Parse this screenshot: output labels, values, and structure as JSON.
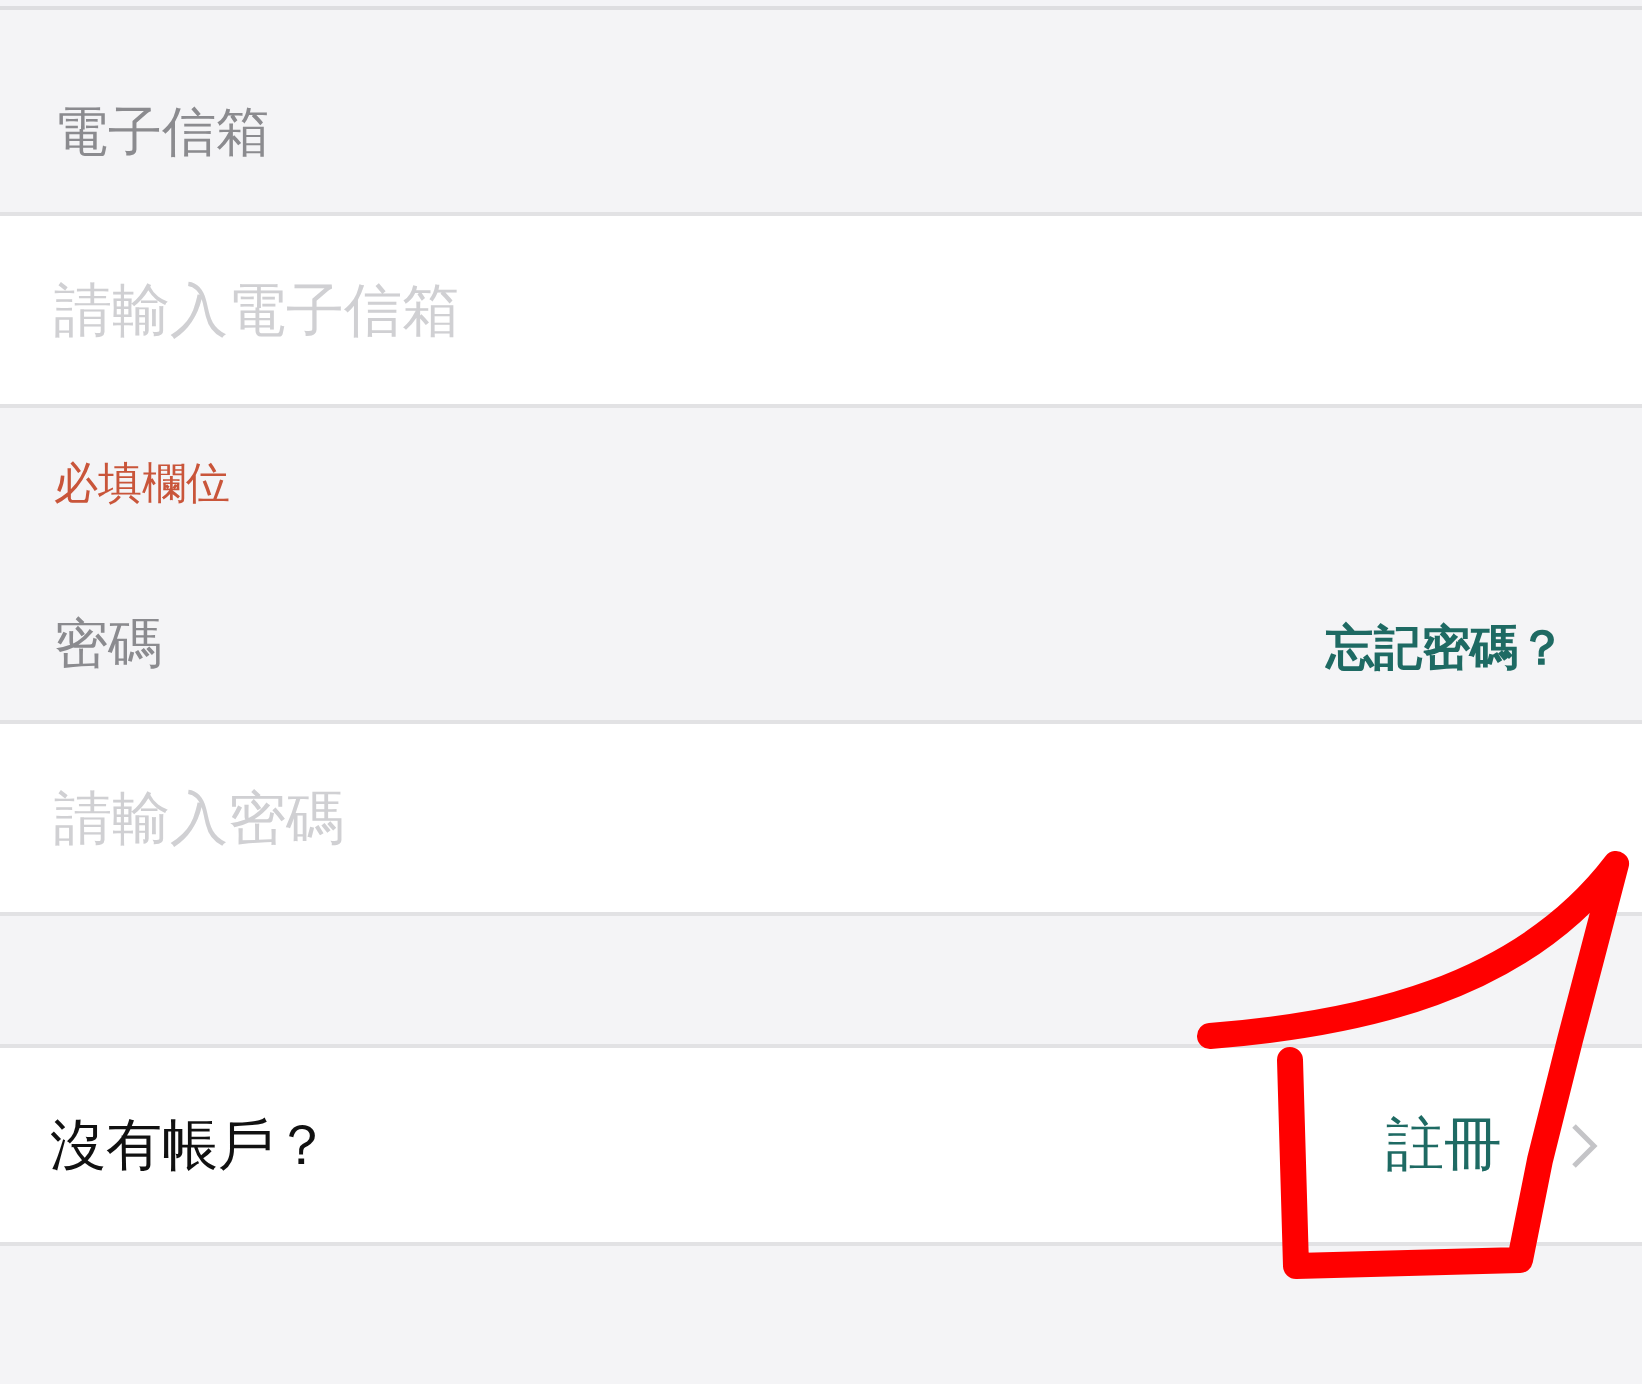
{
  "email": {
    "label": "電子信箱",
    "placeholder": "請輸入電子信箱",
    "error": "必填欄位"
  },
  "password": {
    "label": "密碼",
    "forgot_link": "忘記密碼？",
    "placeholder": "請輸入密碼"
  },
  "signup_row": {
    "prompt": "沒有帳戶？",
    "link": "註冊"
  }
}
